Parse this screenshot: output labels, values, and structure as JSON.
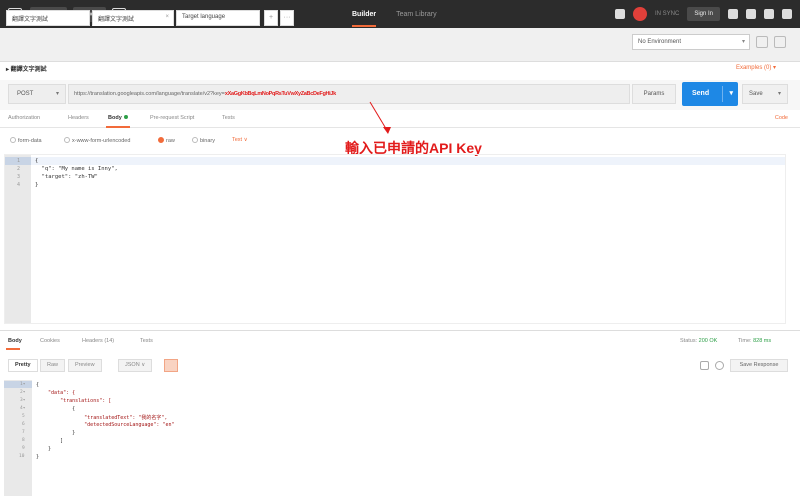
{
  "toolbar": {
    "runner_label": "Runner",
    "import_label": "Import",
    "tabs": [
      "Builder",
      "Team Library"
    ],
    "sync_label": "IN SYNC",
    "signin_label": "Sign In"
  },
  "tabs": {
    "open": [
      "翻譯文字測試",
      "翻譯文字測試",
      "Target language"
    ],
    "add_label": "+",
    "more_label": "···"
  },
  "environment": {
    "selected": "No Environment"
  },
  "request": {
    "title": "▸ 翻譯文字測試",
    "examples_label": "Examples (0) ▾",
    "method": "POST",
    "url_prefix": "https://translation.googleapis.com/language/translate/v2?key=",
    "url_key": "xXaGgKbBqLmNoPqRsTuVwXyZaBcDeFgHiJk",
    "params_label": "Params",
    "send_label": "Send",
    "save_label": "Save",
    "tabs": [
      "Authorization",
      "Headers",
      "Body",
      "Pre-request Script",
      "Tests"
    ],
    "code_label": "Code",
    "body_types": [
      "form-data",
      "x-www-form-urlencoded",
      "raw",
      "binary"
    ],
    "text_dropdown": "Text ∨",
    "body_lines": [
      "{",
      "  \"q\": \"My name is Inny\",",
      "  \"target\": \"zh-TW\"",
      "}"
    ]
  },
  "annotation": "輸入已申請的API Key",
  "response": {
    "tabs": [
      "Body",
      "Cookies",
      "Headers (14)",
      "Tests"
    ],
    "status_label": "Status:",
    "status_value": "200 OK",
    "time_label": "Time:",
    "time_value": "828 ms",
    "view_buttons": [
      "Pretty",
      "Raw",
      "Preview"
    ],
    "format": "JSON ∨",
    "save_label": "Save Response",
    "lines": [
      "{",
      "    \"data\": {",
      "        \"translations\": [",
      "            {",
      "                \"translatedText\": \"我的名字\",",
      "                \"detectedSourceLanguage\": \"en\"",
      "            }",
      "        ]",
      "    }",
      "}"
    ]
  },
  "colors": {
    "accent": "#f26b3a",
    "send": "#1e88e5",
    "annotation": "#e21b1b"
  }
}
